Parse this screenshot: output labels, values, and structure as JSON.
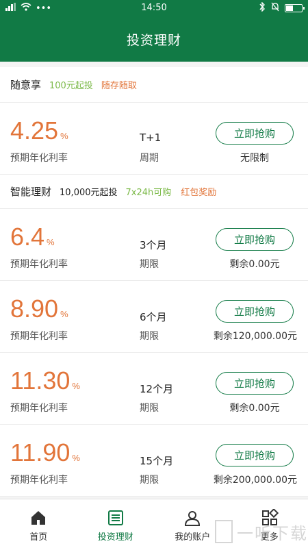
{
  "status": {
    "dots": "•••",
    "time": "14:50"
  },
  "header": {
    "title": "投资理财"
  },
  "section1": {
    "name": "随意享",
    "min": "100元起投",
    "tag1": "随存随取"
  },
  "section2": {
    "name": "智能理财",
    "min": "10,000元起投",
    "tag1": "7x24h可购",
    "tag2": "红包奖励"
  },
  "products": [
    {
      "rate": "4.25",
      "pct": "%",
      "rate_label": "预期年化利率",
      "term": "T+1",
      "term_label": "周期",
      "button": "立即抢购",
      "remain": "无限制"
    },
    {
      "rate": "6.4",
      "pct": "%",
      "rate_label": "预期年化利率",
      "term": "3个月",
      "term_label": "期限",
      "button": "立即抢购",
      "remain": "剩余0.00元"
    },
    {
      "rate": "8.90",
      "pct": "%",
      "rate_label": "预期年化利率",
      "term": "6个月",
      "term_label": "期限",
      "button": "立即抢购",
      "remain": "剩余120,000.00元"
    },
    {
      "rate": "11.30",
      "pct": "%",
      "rate_label": "预期年化利率",
      "term": "12个月",
      "term_label": "期限",
      "button": "立即抢购",
      "remain": "剩余0.00元"
    },
    {
      "rate": "11.90",
      "pct": "%",
      "rate_label": "预期年化利率",
      "term": "15个月",
      "term_label": "期限",
      "button": "立即抢购",
      "remain": "剩余200,000.00元"
    }
  ],
  "tabs": [
    {
      "label": "首页",
      "icon": "home-icon"
    },
    {
      "label": "投资理财",
      "icon": "list-icon",
      "active": true
    },
    {
      "label": "我的账户",
      "icon": "user-icon"
    },
    {
      "label": "更多",
      "icon": "grid-icon"
    }
  ],
  "watermark": {
    "text": "一听下载"
  },
  "colors": {
    "brand": "#117a45",
    "rate": "#e2753a",
    "tag_green": "#7dba4a",
    "tag_orange": "#e2753a"
  }
}
